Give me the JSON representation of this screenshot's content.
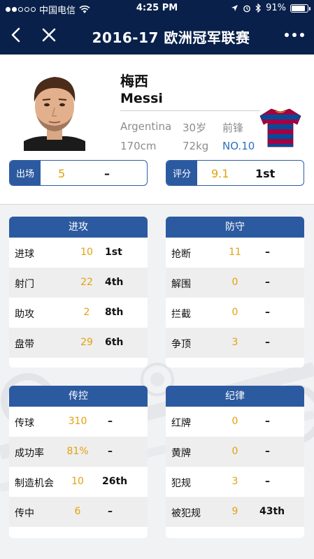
{
  "status_bar": {
    "carrier": "中国电信",
    "time": "4:25 PM",
    "battery": "91%",
    "battery_level": 0.91
  },
  "nav": {
    "title": "2016-17 欧洲冠军联赛",
    "back_icon": "chevron-left-icon",
    "close_icon": "close-icon",
    "more_icon": "more-dots-icon"
  },
  "player": {
    "name_cn": "梅西",
    "name_en": "Messi",
    "nationality": "Argentina",
    "age": "30岁",
    "position": "前锋",
    "height": "170cm",
    "weight": "72kg",
    "number": "NO.10",
    "jersey_colors": [
      "#a50044",
      "#004d98",
      "#edbb00"
    ]
  },
  "appearances": {
    "label": "出场",
    "value": "5",
    "rank": "–"
  },
  "rating": {
    "label": "评分",
    "value": "9.1",
    "rank": "1st"
  },
  "colors": {
    "accent": "#2c5aa0",
    "value_gold": "#e2a10c",
    "nav_bg": "#08204a",
    "number_blue": "#2d6fc1"
  },
  "sections": [
    {
      "title": "进攻",
      "rows": [
        {
          "label": "进球",
          "value": "10",
          "rank": "1st"
        },
        {
          "label": "射门",
          "value": "22",
          "rank": "4th"
        },
        {
          "label": "助攻",
          "value": "2",
          "rank": "8th"
        },
        {
          "label": "盘带",
          "value": "29",
          "rank": "6th"
        }
      ]
    },
    {
      "title": "防守",
      "rows": [
        {
          "label": "抢断",
          "value": "11",
          "rank": "–"
        },
        {
          "label": "解围",
          "value": "0",
          "rank": "–"
        },
        {
          "label": "拦截",
          "value": "0",
          "rank": "–"
        },
        {
          "label": "争顶",
          "value": "3",
          "rank": "–"
        }
      ]
    },
    {
      "title": "传控",
      "rows": [
        {
          "label": "传球",
          "value": "310",
          "rank": "–"
        },
        {
          "label": "成功率",
          "value": "81%",
          "rank": "–"
        },
        {
          "label": "制造机会",
          "value": "10",
          "rank": "26th"
        },
        {
          "label": "传中",
          "value": "6",
          "rank": "–"
        }
      ]
    },
    {
      "title": "纪律",
      "rows": [
        {
          "label": "红牌",
          "value": "0",
          "rank": "–"
        },
        {
          "label": "黄牌",
          "value": "0",
          "rank": "–"
        },
        {
          "label": "犯规",
          "value": "3",
          "rank": "–"
        },
        {
          "label": "被犯规",
          "value": "9",
          "rank": "43th"
        }
      ]
    }
  ]
}
